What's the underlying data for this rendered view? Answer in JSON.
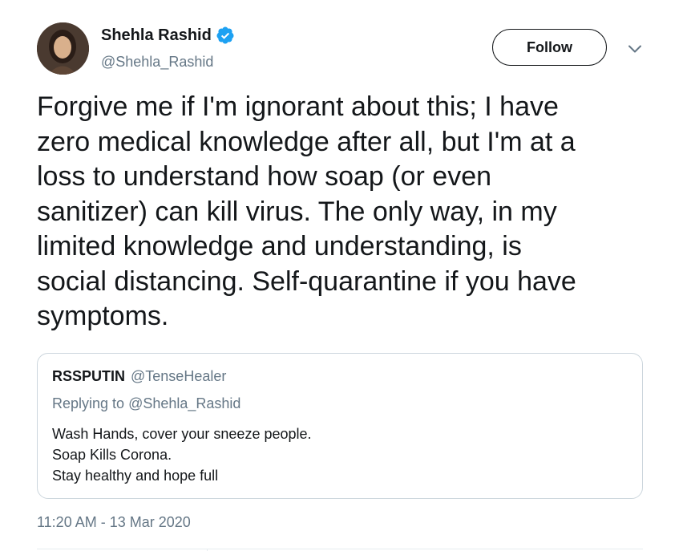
{
  "author": {
    "display_name": "Shehla Rashid",
    "handle": "@Shehla_Rashid",
    "verified": true
  },
  "actions": {
    "follow_label": "Follow"
  },
  "tweet": {
    "text": "Forgive me if I'm ignorant about this; I have\nzero medical knowledge after all, but I'm at a\nloss to understand how soap (or even\nsanitizer) can kill virus. The only way, in my\nlimited knowledge and understanding, is\nsocial distancing. Self-quarantine if you have\nsymptoms.",
    "timestamp": "11:20 AM - 13 Mar 2020"
  },
  "quoted": {
    "display_name": "RSSPUTIN",
    "handle": "@TenseHealer",
    "replying_prefix": "Replying to",
    "replying_to": "@Shehla_Rashid",
    "lines": [
      "Wash Hands, cover your sneeze people.",
      "Soap Kills Corona.",
      "Stay healthy and hope full"
    ]
  },
  "colors": {
    "verified_badge": "#1da1f2",
    "secondary_text": "#657786",
    "border": "#ccd6dd"
  },
  "icons": {
    "verified": "verified-badge-icon",
    "more": "chevron-down-icon"
  }
}
